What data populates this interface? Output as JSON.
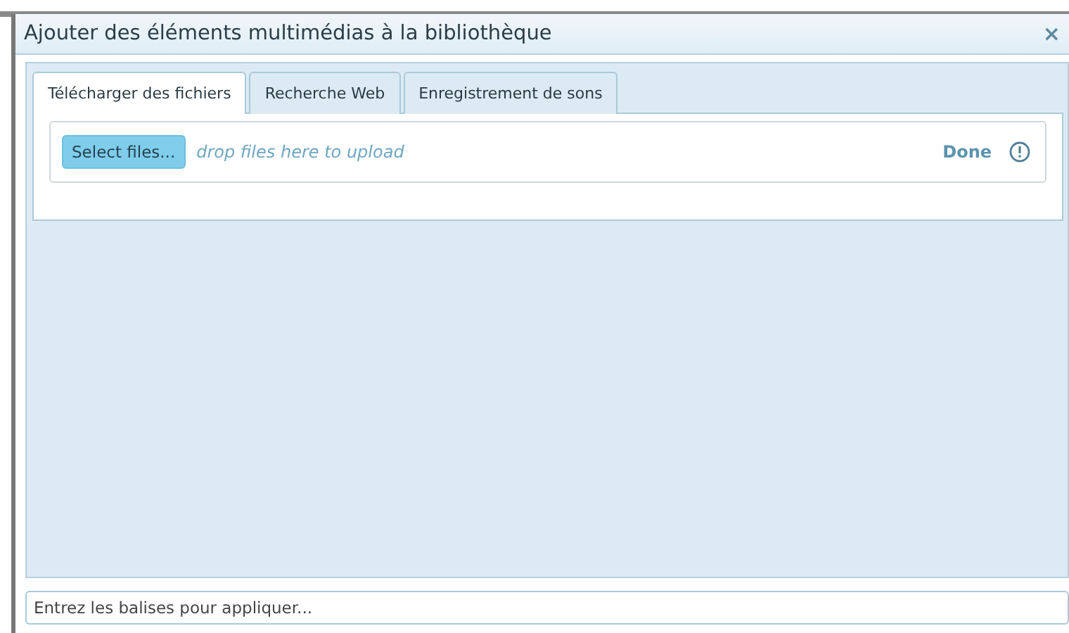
{
  "window": {
    "title": "Ajouter des éléments multimédias à la bibliothèque",
    "close": "×"
  },
  "tabs": [
    {
      "label": "Télécharger des fichiers",
      "selected": true
    },
    {
      "label": "Recherche Web",
      "selected": false
    },
    {
      "label": "Enregistrement de sons",
      "selected": false
    }
  ],
  "upload": {
    "button": "Select files...",
    "hint": "drop files here to upload",
    "done": "Done"
  },
  "tags_field": {
    "placeholder": "Entrez les balises pour appliquer..."
  }
}
